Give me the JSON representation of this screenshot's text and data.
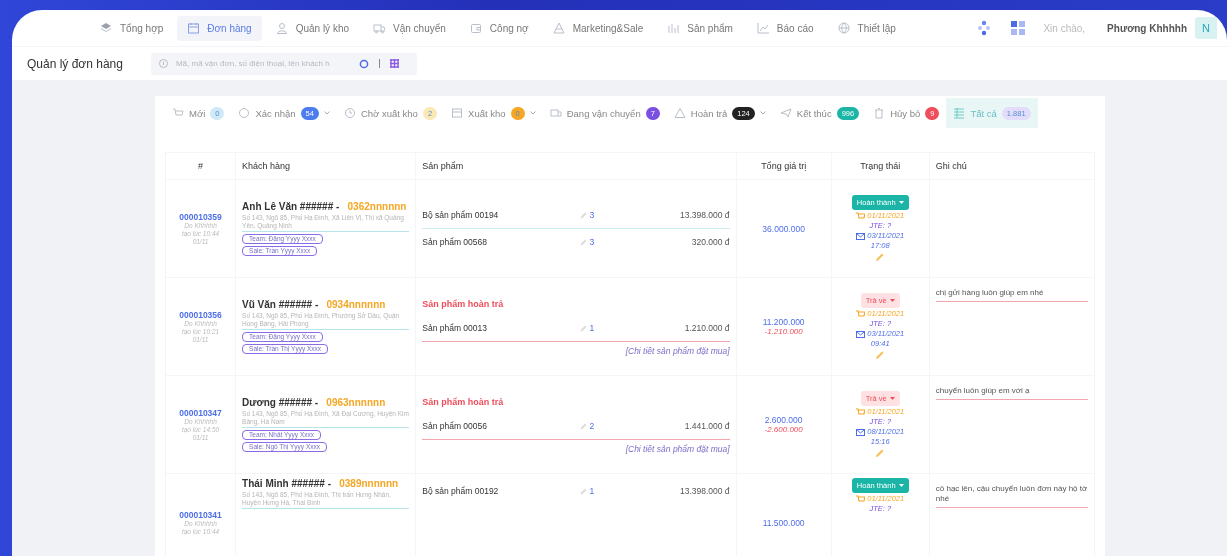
{
  "nav": {
    "items": [
      {
        "label": "Tổng hợp",
        "selected": false
      },
      {
        "label": "Đơn hàng",
        "selected": true
      },
      {
        "label": "Quản lý kho",
        "selected": false
      },
      {
        "label": "Vận chuyển",
        "selected": false
      },
      {
        "label": "Công nợ",
        "selected": false
      },
      {
        "label": "Marketing&Sale",
        "selected": false
      },
      {
        "label": "Sản phẩm",
        "selected": false
      },
      {
        "label": "Báo cáo",
        "selected": false
      },
      {
        "label": "Thiết lập",
        "selected": false
      }
    ],
    "greeting": "Xin chào,",
    "user_name": "Phương Khhhhh",
    "avatar_letter": "N"
  },
  "page_title": "Quản lý đơn hàng",
  "search": {
    "placeholder": "Mã, mã vận đơn, số điện thoại, tên khách h"
  },
  "tabs": [
    {
      "label": "Mới",
      "count": "0",
      "color": "#cfe9f7",
      "dropdown": false,
      "selected": false
    },
    {
      "label": "Xác nhận",
      "count": "54",
      "color": "#4d7cf0",
      "dropdown": true,
      "selected": false
    },
    {
      "label": "Chờ xuất kho",
      "count": "2",
      "color": "#fbe9b5",
      "dropdown": false,
      "selected": false
    },
    {
      "label": "Xuất kho",
      "count": "0",
      "color": "#f5a623",
      "dropdown": true,
      "selected": false
    },
    {
      "label": "Đang vận chuyển",
      "count": "7",
      "color": "#7b4fe0",
      "dropdown": false,
      "selected": false
    },
    {
      "label": "Hoàn trả",
      "count": "124",
      "color": "#222222",
      "dropdown": true,
      "selected": false
    },
    {
      "label": "Kết thúc",
      "count": "996",
      "color": "#1bb5a8",
      "dropdown": false,
      "selected": false
    },
    {
      "label": "Hủy bỏ",
      "count": "9",
      "color": "#ef4d5a",
      "dropdown": false,
      "selected": false
    },
    {
      "label": "Tất cả",
      "count": "1.881",
      "color": "#e3dcfb",
      "dropdown": false,
      "selected": true
    }
  ],
  "table": {
    "columns": [
      "#",
      "Khách hàng",
      "Sản phẩm",
      "Tổng giá trị",
      "Trạng thái",
      "Ghi chú"
    ],
    "rows": [
      {
        "id": "000010359",
        "creator": "Do Khhhhh",
        "created_time": "tạo lúc 10:44",
        "created_date": "01/11",
        "customer": "Anh Lê Văn ###### -",
        "phone": "0362nnnnnn",
        "address": "Số 143, Ngõ 85, Phố Hạ Đình, Xã Liên Vị, Thị xã Quảng Yên, Quảng Ninh",
        "team": "Team: Đặng Yyyy Xxxx",
        "sale": "Sale: Trần Yyyy Xxxx",
        "products": [
          {
            "name": "Bộ sản phẩm 00194",
            "qty": "3",
            "price": "13.398.000 đ"
          },
          {
            "name": "Sản phẩm 00568",
            "qty": "3",
            "price": "320.000 đ"
          }
        ],
        "total": "36.000.000",
        "status": {
          "label": "Hoàn thành",
          "kind": "done"
        },
        "ship_date": "01/11/2021",
        "carrier": "JTE: ?",
        "delivered": "03/11/2021",
        "delivered_time": "17:08"
      },
      {
        "id": "000010356",
        "creator": "Do Khhhhh",
        "created_time": "tạo lúc 10:21",
        "created_date": "01/11",
        "customer": "Vũ Văn ###### -",
        "phone": "0934nnnnnn",
        "address": "Số 143, Ngõ 85, Phố Hạ Đình, Phường Sở Dầu, Quận Hồng Bàng, Hải Phòng",
        "team": "Team: Đặng Yyyy Xxxx",
        "sale": "Sale: Trần Thị Yyyy Xxxx",
        "returned_label": "Sản phẩm hoàn trả",
        "products": [
          {
            "name": "Sản phẩm 00013",
            "qty": "1",
            "price": "1.210.000 đ"
          }
        ],
        "detail_link": "[Chi tiết sản phẩm đặt mua]",
        "total": "11.200.000",
        "refund": "-1.210.000",
        "status": {
          "label": "Trả về",
          "kind": "returned"
        },
        "ship_date": "01/11/2021",
        "carrier": "JTE: ?",
        "delivered": "03/11/2021",
        "delivered_time": "09:41",
        "note": "chị gửi hàng luôn giúp em nhé"
      },
      {
        "id": "000010347",
        "creator": "Do Khhhhh",
        "created_time": "tạo lúc 14:50",
        "created_date": "01/11",
        "customer": "Dương ###### -",
        "phone": "0963nnnnnn",
        "address": "Số 143, Ngõ 85, Phố Hạ Đình, Xã Đại Cương, Huyện Kim Bảng, Hà Nam",
        "team": "Team: Nhật Yyyy Xxxx",
        "sale": "Sale: Ngô Thị Yyyy Xxxx",
        "returned_label": "Sản phẩm hoàn trả",
        "products": [
          {
            "name": "Sản phẩm 00056",
            "qty": "2",
            "price": "1.441.000 đ"
          }
        ],
        "detail_link": "[Chi tiết sản phẩm đặt mua]",
        "total": "2.600.000",
        "refund": "-2.600.000",
        "status": {
          "label": "Trả về",
          "kind": "returned"
        },
        "ship_date": "01/11/2021",
        "carrier": "JTE: ?",
        "delivered": "08/11/2021",
        "delivered_time": "15:16",
        "note": "chuyển luôn giúp em với ạ"
      },
      {
        "id": "000010341",
        "creator": "Do Khhhhh",
        "created_time": "tạo lúc 10:44",
        "customer": "Thái Minh ###### -",
        "phone": "0389nnnnnn",
        "address": "Số 143, Ngõ 85, Phố Hạ Đình, Thị trấn Hưng Nhân, Huyện Hưng Hà, Thái Bình",
        "products": [
          {
            "name": "Bộ sản phẩm 00192",
            "qty": "1",
            "price": "13.398.000 đ"
          }
        ],
        "total": "11.500.000",
        "status": {
          "label": "Hoàn thành",
          "kind": "done"
        },
        "ship_date": "01/11/2021",
        "carrier": "JTE: ?",
        "note": "cô hạc lên, cậu chuyển luôn đơn này hộ tớ nhé"
      }
    ]
  }
}
